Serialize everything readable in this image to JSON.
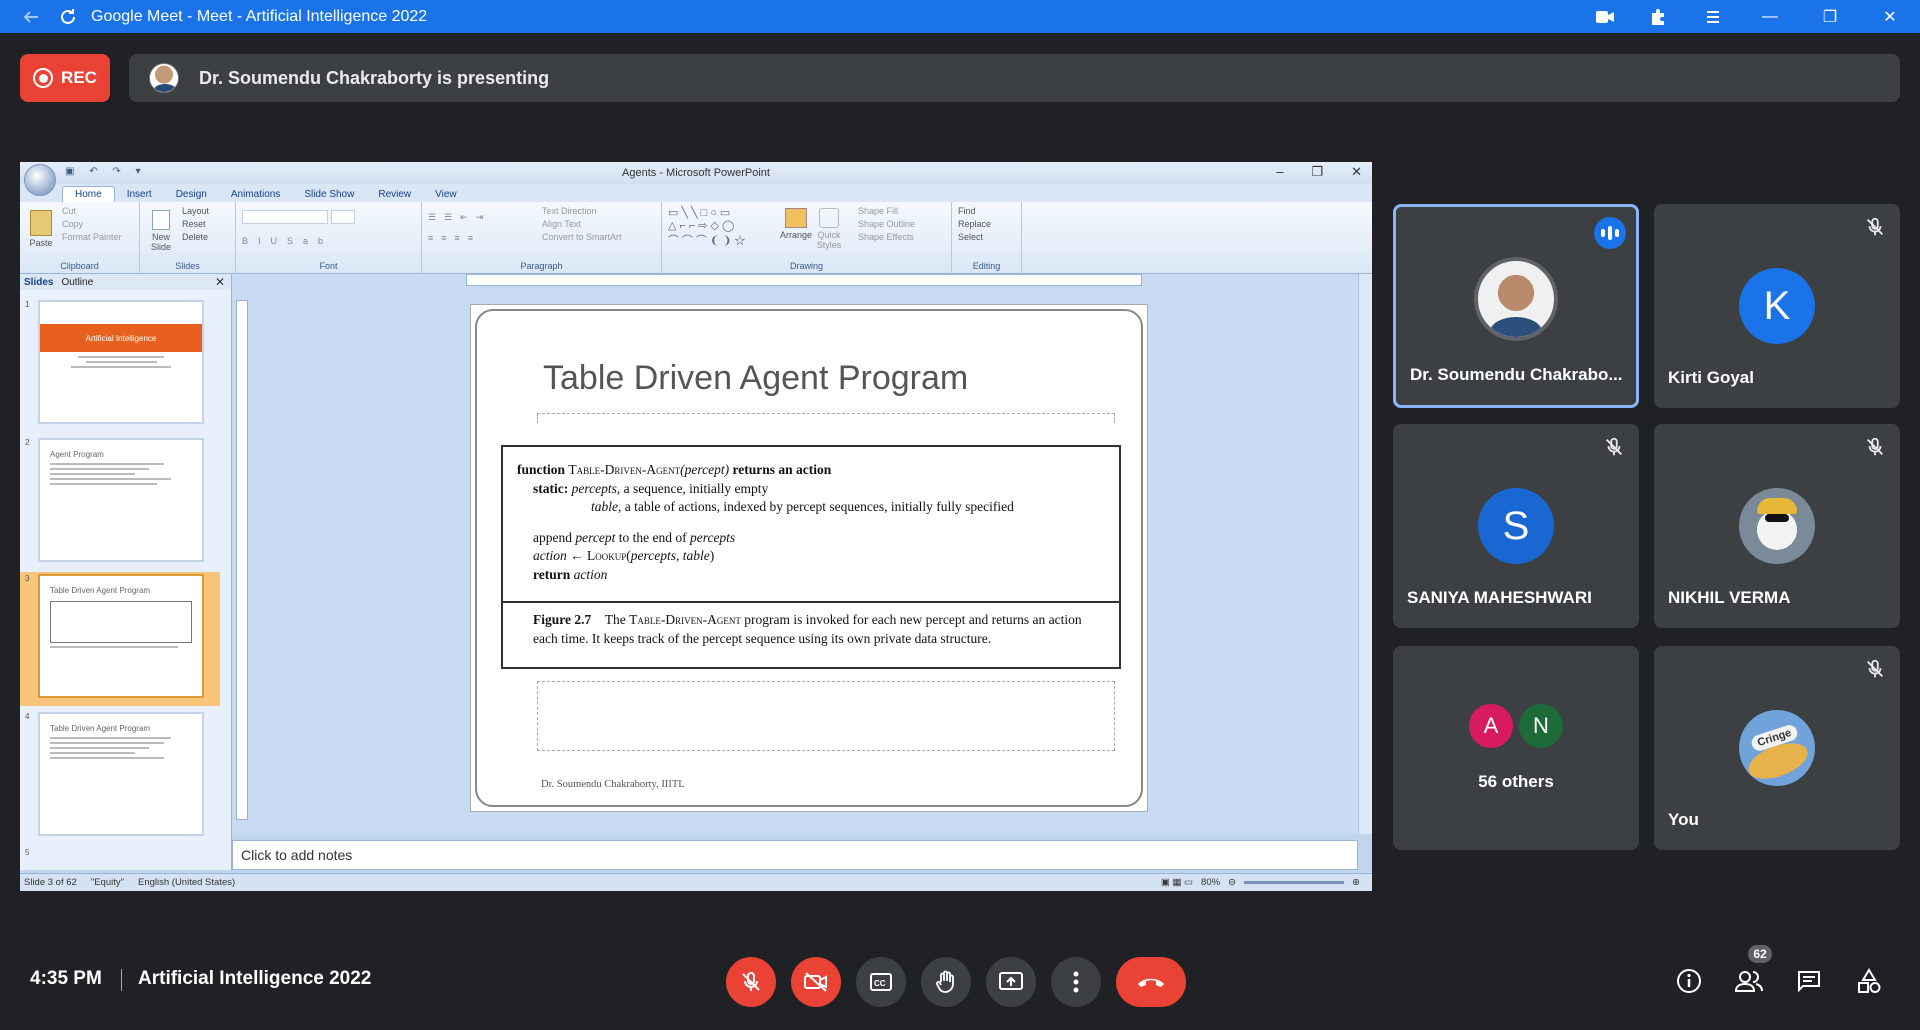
{
  "browser": {
    "title": "Google Meet - Meet - Artificial Intelligence 2022",
    "accent": "#1a73e8"
  },
  "top": {
    "rec_label": "REC",
    "presenting_text": "Dr. Soumendu Chakraborty is presenting"
  },
  "ppt": {
    "window_title": "Agents - Microsoft PowerPoint",
    "tabs": [
      "Home",
      "Insert",
      "Design",
      "Animations",
      "Slide Show",
      "Review",
      "View"
    ],
    "groups": {
      "clipboard": "Clipboard",
      "slides": "Slides",
      "font": "Font",
      "paragraph": "Paragraph",
      "drawing": "Drawing",
      "editing": "Editing"
    },
    "clipboard_items": [
      "Cut",
      "Copy",
      "Format Painter"
    ],
    "paste_label": "Paste",
    "slides_items": [
      "Layout",
      "Reset",
      "Delete"
    ],
    "new_slide_label": "New Slide",
    "paragraph_items": [
      "Text Direction",
      "Align Text",
      "Convert to SmartArt"
    ],
    "drawing_items": [
      "Shape Fill",
      "Shape Outline",
      "Shape Effects"
    ],
    "arrange_label": "Arrange",
    "quick_styles_label": "Quick Styles",
    "editing_items": [
      "Find",
      "Replace",
      "Select"
    ],
    "panel_tabs": [
      "Slides",
      "Outline"
    ],
    "thumbs": [
      {
        "num": "1",
        "title": "Artificial Intelligence"
      },
      {
        "num": "2",
        "title": "Agent Program"
      },
      {
        "num": "3",
        "title": "Table Driven Agent Program"
      },
      {
        "num": "4",
        "title": "Table Driven Agent Program"
      },
      {
        "num": "5",
        "title": ""
      }
    ],
    "slide": {
      "title": "Table Driven Agent Program",
      "algo": {
        "l1a": "function ",
        "l1b": "Table-Driven-Agent",
        "l1c": "(percept)",
        "l1d": " returns an action",
        "l2a": "static: ",
        "l2b": "percepts",
        "l2c": ", a sequence, initially empty",
        "l3a": "table",
        "l3b": ", a table of actions, indexed by percept sequences, initially fully specified",
        "l4a": "append ",
        "l4b": "percept",
        "l4c": " to the end of ",
        "l4d": "percepts",
        "l5a": "action",
        "l5b": " ← Lookup(",
        "l5c": "percepts, table",
        "l5d": ")",
        "l6a": "return ",
        "l6b": "action"
      },
      "caption_label": "Figure 2.7",
      "caption_a": "The ",
      "caption_b": "Table-Driven-Agent",
      "caption_c": " program is invoked for each new percept and returns an action each time. It keeps track of the percept sequence using its own private data structure.",
      "footer": "Dr. Soumendu Chakraborty, IIITL"
    },
    "notes_placeholder": "Click to add notes",
    "status": {
      "slide": "Slide 3 of 62",
      "theme": "\"Equity\"",
      "language": "English (United States)",
      "zoom": "80%"
    }
  },
  "participants": [
    {
      "name": "Dr. Soumendu Chakrabo...",
      "speaking": true
    },
    {
      "name": "Kirti Goyal",
      "initial": "K",
      "color": "#1a73e8"
    },
    {
      "name": "SANIYA MAHESHWARI",
      "initial": "S",
      "color": "#1967d2"
    },
    {
      "name": "NIKHIL VERMA"
    },
    {
      "others": "56 others",
      "a": "A",
      "n": "N",
      "a_color": "#d81b60",
      "n_color": "#1e6b3a"
    },
    {
      "name": "You",
      "sticker": "Cringe"
    }
  ],
  "bottom": {
    "time": "4:35 PM",
    "meeting": "Artificial Intelligence 2022",
    "people_count": "62"
  }
}
